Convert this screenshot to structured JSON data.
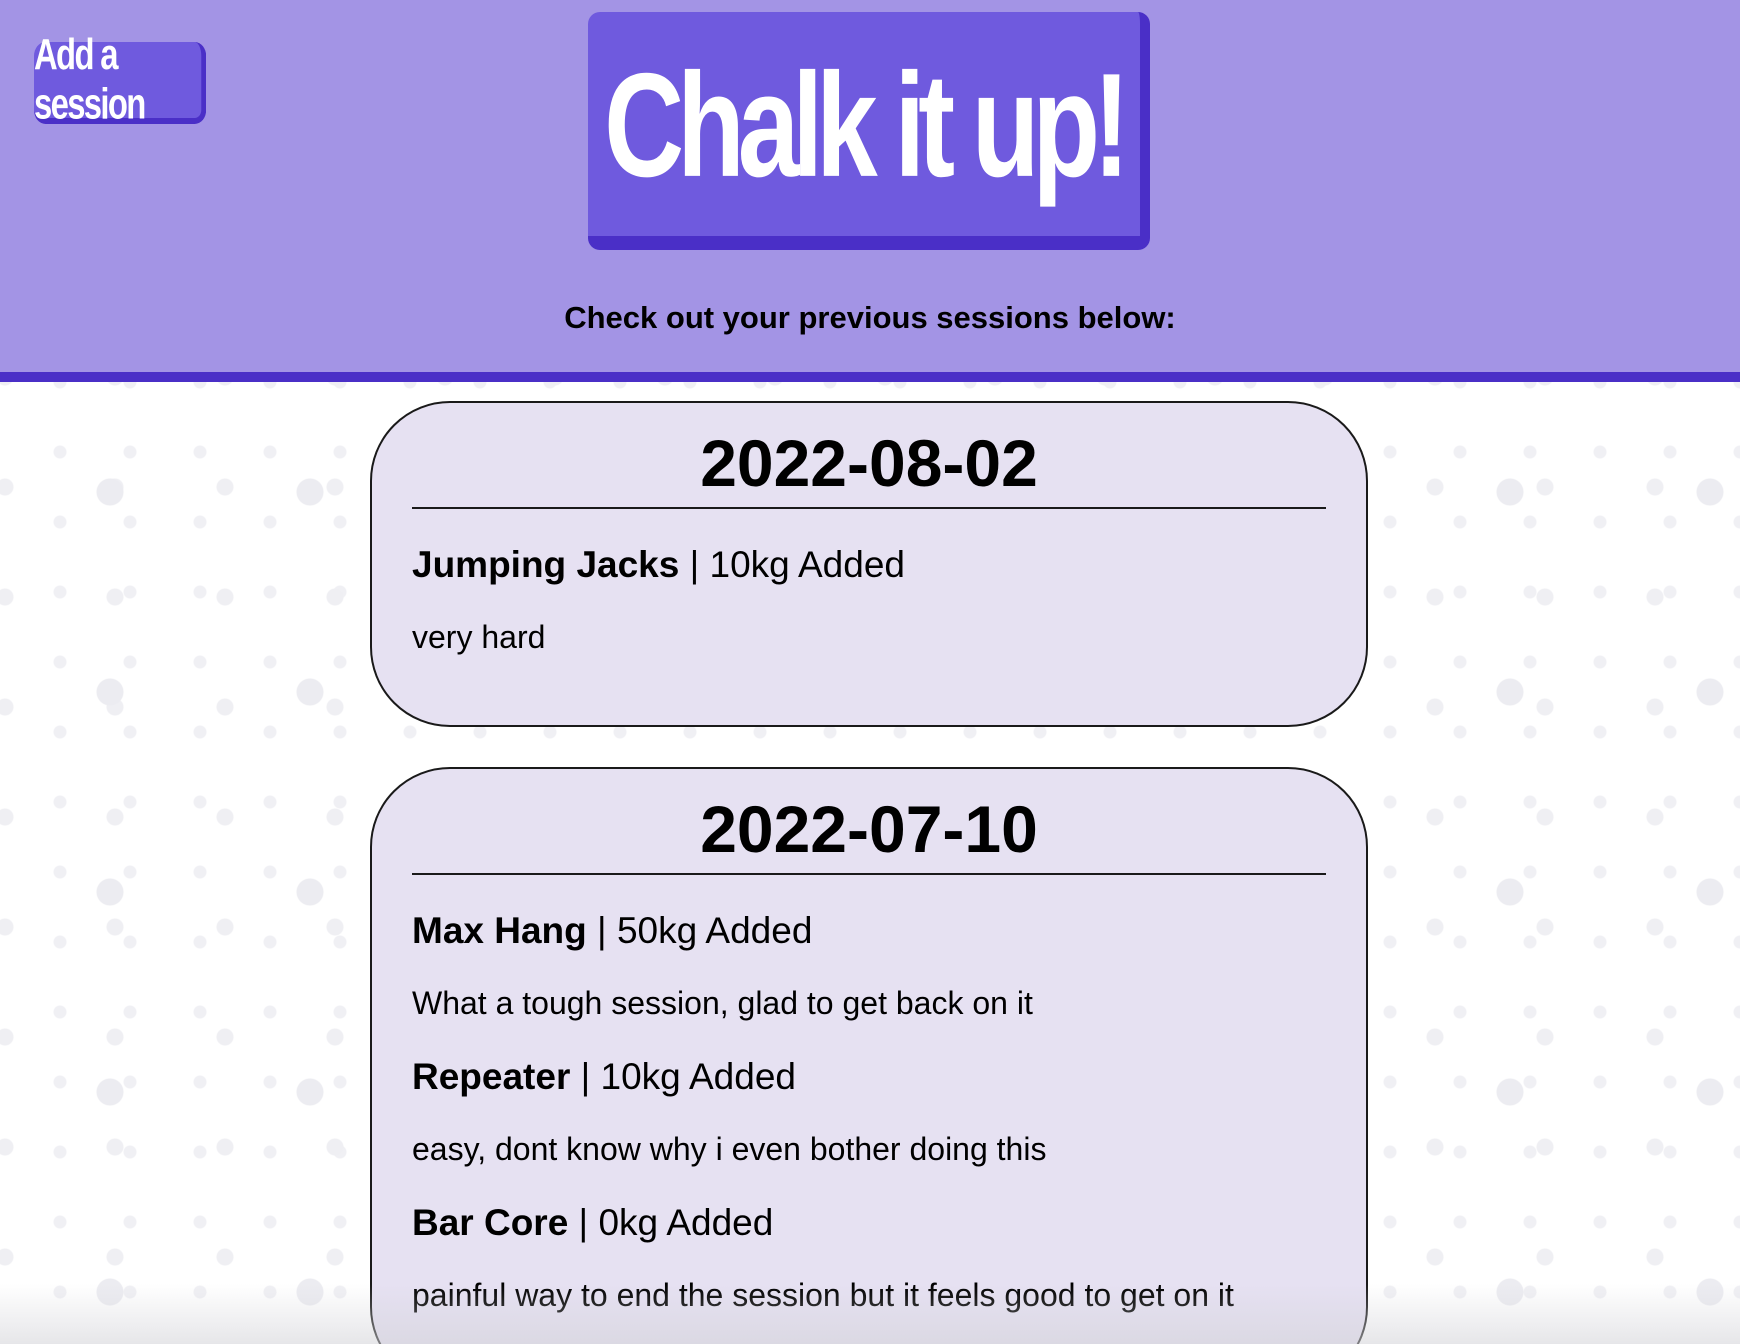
{
  "header": {
    "add_session_label": "Add a session",
    "logo_text": "Chalk it up!",
    "subtitle": "Check out your previous sessions below:"
  },
  "sessions": [
    {
      "date": "2022-08-02",
      "exercises": [
        {
          "name": "Jumping Jacks",
          "separator": " | ",
          "weight": "10kg Added",
          "note": "very hard"
        }
      ]
    },
    {
      "date": "2022-07-10",
      "exercises": [
        {
          "name": "Max Hang",
          "separator": " | ",
          "weight": "50kg Added",
          "note": "What a tough session, glad to get back on it"
        },
        {
          "name": "Repeater",
          "separator": " | ",
          "weight": "10kg Added",
          "note": "easy, dont know why i even bother doing this"
        },
        {
          "name": "Bar Core",
          "separator": " | ",
          "weight": "0kg Added",
          "note": "painful way to end the session but it feels good to get on it"
        }
      ]
    }
  ],
  "colors": {
    "header_bg": "#a394e5",
    "accent": "#6f5ade",
    "accent_dark": "#4a2fc7",
    "card_bg": "#e6e1f2"
  }
}
